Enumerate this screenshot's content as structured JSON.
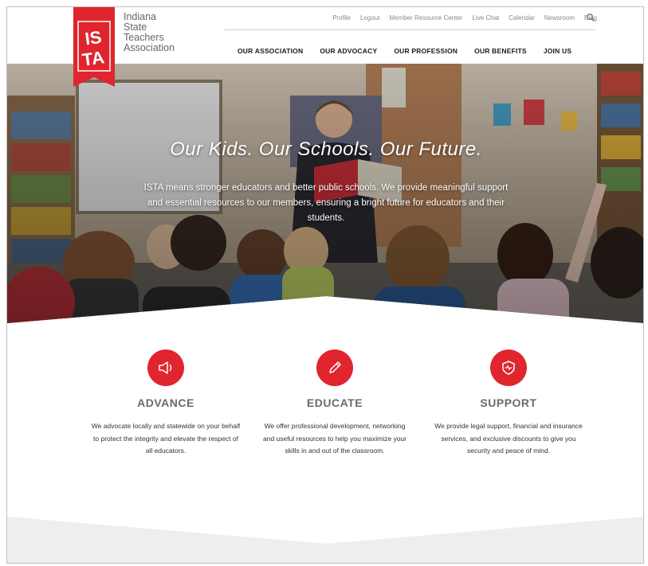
{
  "org": {
    "logo_text": "ISTA",
    "name_lines": [
      "Indiana",
      "State",
      "Teachers",
      "Association"
    ]
  },
  "utility_nav": [
    "Profile",
    "Logout",
    "Member Resource Center",
    "Live Chat",
    "Calendar",
    "Newsroom",
    "Blog"
  ],
  "main_nav": [
    "OUR ASSOCIATION",
    "OUR ADVOCACY",
    "OUR PROFESSION",
    "OUR BENEFITS",
    "JOIN US"
  ],
  "hero": {
    "title": "Our Kids. Our Schools. Our Future.",
    "copy": "ISTA means stronger educators and better public schools. We provide meaningful support and essential resources to our members, ensuring a bright future for educators and their students."
  },
  "features": [
    {
      "icon": "megaphone-icon",
      "title": "ADVANCE",
      "text": "We advocate locally and statewide on your behalf to protect the integrity and elevate the respect of all educators."
    },
    {
      "icon": "pencil-icon",
      "title": "EDUCATE",
      "text": "We offer professional development, networking and useful resources to help you maximize your skills in and out of the classroom."
    },
    {
      "icon": "shield-pulse-icon",
      "title": "SUPPORT",
      "text": "We provide legal support, financial and insurance services, and exclusive discounts to give you security and peace of mind."
    }
  ],
  "colors": {
    "brand_red": "#e0252f",
    "nav_text": "#1a1a1a"
  }
}
